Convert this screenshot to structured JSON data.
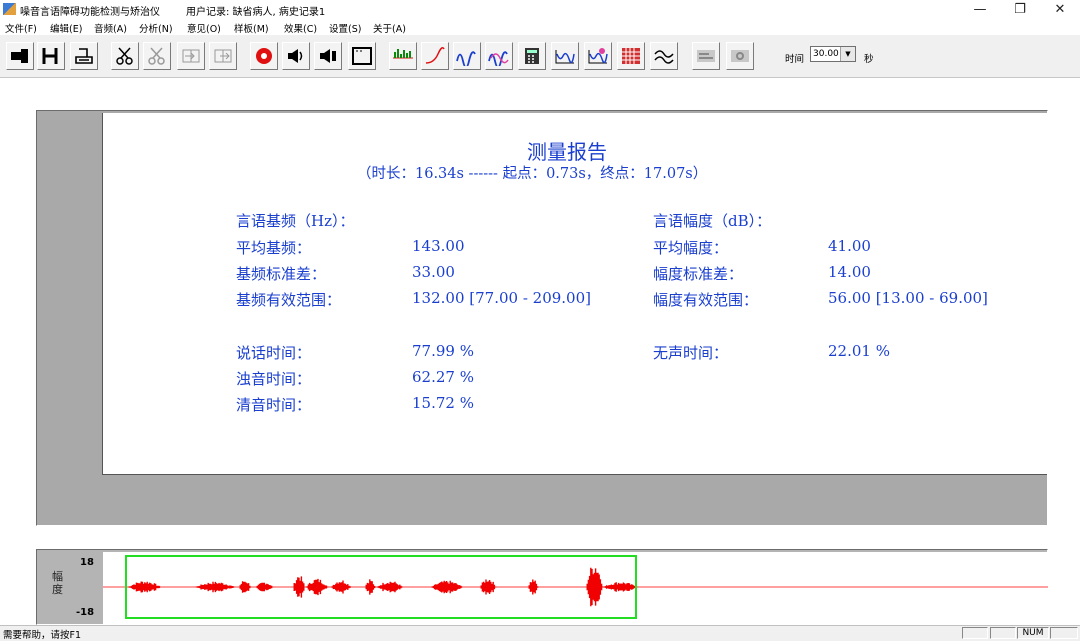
{
  "window": {
    "title": "噪音言语障碍功能检测与矫治仪",
    "user_record": "用户记录: 缺省病人, 病史记录1",
    "minimize": "—",
    "restore": "❐",
    "close": "✕"
  },
  "menu": [
    "文件(F)",
    "编辑(E)",
    "音频(A)",
    "分析(N)",
    "意见(O)",
    "样板(M)",
    "效果(C)",
    "设置(S)",
    "关于(A)"
  ],
  "toolbar": {
    "time_label": "时间",
    "time_value": "30.00",
    "time_unit": "秒",
    "buttons": [
      "open-record-icon",
      "save-icon",
      "print-icon",
      "cut-icon",
      "cut-gray-icon",
      "import-icon",
      "export-icon",
      "record-icon",
      "speaker-icon",
      "speaker-right-icon",
      "frame-icon",
      "spectrum-icon",
      "curve-icon",
      "waveform-blue-icon",
      "waveform-pink-icon",
      "calculator-icon",
      "formant-icon",
      "formant-g-icon",
      "grid-icon",
      "compare-icon",
      "gray-tool1-icon",
      "gray-tool2-icon"
    ]
  },
  "report": {
    "title": "测量报告",
    "subtitle": "（时长：16.34s ------ 起点：0.73s，终点：17.07s）",
    "pitch": {
      "header": "言语基频（Hz）：",
      "rows": [
        {
          "label": "平均基频：",
          "value": "143.00"
        },
        {
          "label": "基频标准差：",
          "value": "33.00"
        },
        {
          "label": "基频有效范围：",
          "value": "132.00 [77.00 - 209.00]"
        }
      ]
    },
    "amplitude": {
      "header": "言语幅度（dB）：",
      "rows": [
        {
          "label": "平均幅度：",
          "value": "41.00"
        },
        {
          "label": "幅度标准差：",
          "value": "14.00"
        },
        {
          "label": "幅度有效范围：",
          "value": "56.00 [13.00 - 69.00]"
        }
      ]
    },
    "timing": {
      "rows": [
        {
          "label": "说话时间：",
          "value": "77.99 %"
        },
        {
          "label": "浊音时间：",
          "value": "62.27 %"
        },
        {
          "label": "清音时间：",
          "value": "15.72 %"
        }
      ],
      "silence": {
        "label": "无声时间：",
        "value": "22.01 %"
      }
    }
  },
  "waveform": {
    "axis_label": "幅度",
    "ymax": "18",
    "ymin": "-18"
  },
  "status": {
    "help": "需要帮助，请按F1",
    "num": "NUM"
  }
}
